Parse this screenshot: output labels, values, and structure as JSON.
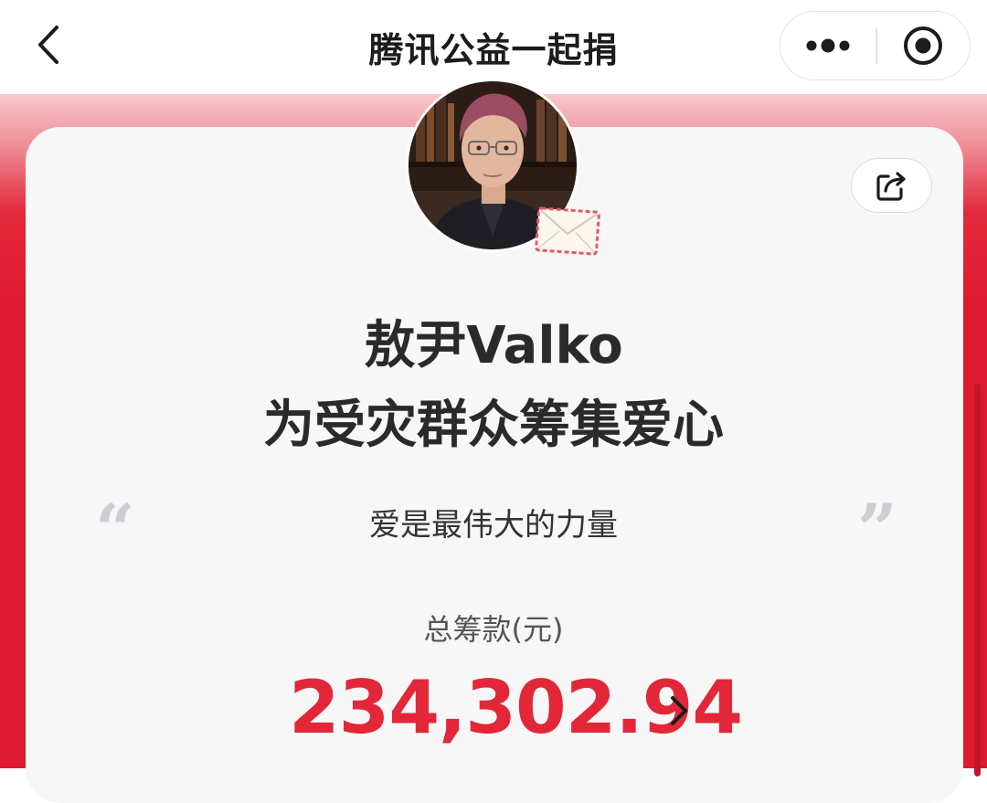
{
  "navbar": {
    "title": "腾讯公益一起捐",
    "back_icon": "chevron-left-icon",
    "more_icon": "more-dots-icon",
    "close_icon": "target-close-icon"
  },
  "card": {
    "share_icon": "share-icon",
    "avatar_icon": "user-avatar",
    "badge_icon": "envelope-icon",
    "name": "敖尹Valko",
    "subtitle": "为受灾群众筹集爱心",
    "quote_open": "“",
    "quote_close": "”",
    "motto": "爱是最伟大的力量",
    "total_label": "总筹款(元)",
    "total_amount": "234,302.94",
    "amount_chevron_icon": "chevron-right-icon"
  },
  "colors": {
    "brand_red": "#de1a30",
    "amount_red": "#e22739",
    "card_bg": "#f7f7f7"
  }
}
